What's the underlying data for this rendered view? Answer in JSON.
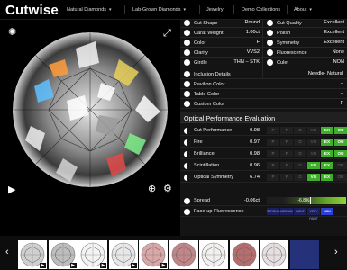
{
  "header": {
    "logo": "Cutwise",
    "nav": [
      {
        "label": "Natural Diamonds",
        "chevron": true
      },
      {
        "label": "Lab-Grown Diamonds",
        "chevron": true
      },
      {
        "label": "Jewelry",
        "chevron": false
      },
      {
        "label": "Demo Collections",
        "chevron": false
      },
      {
        "label": "About",
        "chevron": true
      }
    ]
  },
  "viewer": {
    "icons": [
      "360-icon",
      "expand-icon",
      "play-icon",
      "zoom-in-icon",
      "settings-icon"
    ]
  },
  "specs": {
    "left": [
      {
        "label": "Cut Shape",
        "value": "Round",
        "icon": "dot-icon"
      },
      {
        "label": "Carat Weight",
        "value": "1.00ct",
        "icon": "dot-icon"
      },
      {
        "label": "Color",
        "value": "F",
        "icon": "dot-icon"
      },
      {
        "label": "Clarity",
        "value": "VVS2",
        "icon": "dot-icon"
      },
      {
        "label": "Girdle",
        "value": "THN – STK",
        "icon": "dot-icon"
      }
    ],
    "right": [
      {
        "label": "Cut Quality",
        "value": "Excellent",
        "icon": "dot-icon"
      },
      {
        "label": "Polish",
        "value": "Excellent",
        "icon": "dot-icon"
      },
      {
        "label": "Symmetry",
        "value": "Excellent",
        "icon": "dot-icon"
      },
      {
        "label": "Fluorescence",
        "value": "None",
        "icon": "dot-icon"
      },
      {
        "label": "Culet",
        "value": "NON",
        "icon": "dot-icon"
      }
    ],
    "full": [
      {
        "label": "Inclusion Details",
        "value": "Needle- Natural"
      },
      {
        "label": "Pavilion Color",
        "value": "–"
      },
      {
        "label": "Table Color",
        "value": "–"
      },
      {
        "label": "Custom Color",
        "value": "F"
      }
    ]
  },
  "evaluation": {
    "title": "Optical Performance Evaluation",
    "grade_labels": [
      "P",
      "F",
      "G",
      "VG",
      "EX",
      "OU"
    ],
    "rows": [
      {
        "label": "Cut Performance",
        "value": "0.98",
        "active": [
          4,
          5
        ],
        "icon": "half-circle-icon"
      },
      {
        "label": "Fire",
        "value": "0.97",
        "active": [
          4,
          5
        ],
        "icon": "fire-icon"
      },
      {
        "label": "Brilliance",
        "value": "0.98",
        "active": [
          4,
          5
        ],
        "icon": "half-circle-icon"
      },
      {
        "label": "Scintillation",
        "value": "0.96",
        "active": [
          3,
          4
        ],
        "icon": "half-circle-icon"
      },
      {
        "label": "Optical Symmetry",
        "value": "6.74",
        "active": [
          3,
          4
        ],
        "icon": "symmetry-icon"
      }
    ],
    "spread": {
      "label": "Spread",
      "value": "-0.06ct",
      "percent": "-6.8%",
      "marker_fraction": 0.55
    },
    "fluorescence": {
      "label": "Face-up Fluorescence",
      "scale": [
        "STRONG",
        "MEDIUM",
        "FAINT",
        "VERY FAINT",
        "NON"
      ],
      "selected_index": 4
    }
  },
  "thumbnails": {
    "count": 11,
    "play_badges": [
      true,
      true,
      true,
      true,
      true,
      false,
      false,
      false,
      false,
      false,
      false
    ],
    "colors": [
      "#cfcfcf",
      "#bdbdbd",
      "#f3f3f3",
      "#e7e7e7",
      "#d9a7a7",
      "#c0868a",
      "#f2efef",
      "#b56d6d",
      "#e5dfdf",
      "#25327a",
      "#101010"
    ]
  }
}
